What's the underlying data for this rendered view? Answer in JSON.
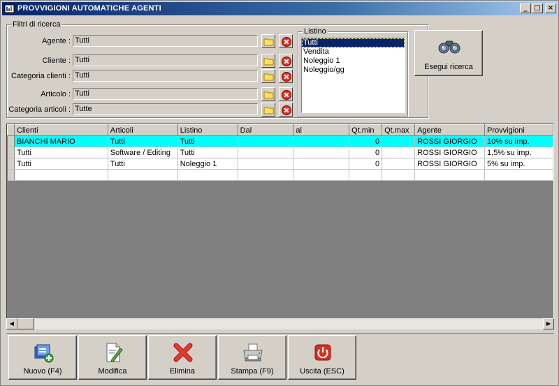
{
  "window": {
    "title": "PROVVIGIONI AUTOMATICHE AGENTI",
    "controls": {
      "minimize": "_",
      "restore": "□",
      "close": "×"
    }
  },
  "filters": {
    "legend": "Filtri di ricerca",
    "agente": {
      "label": "Agente :",
      "value": "Tutti"
    },
    "cliente": {
      "label": "Cliente :",
      "value": "Tutti"
    },
    "categoria_clienti": {
      "label": "Categoria clienti :",
      "value": "Tutti"
    },
    "articolo": {
      "label": "Articolo :",
      "value": "Tutti"
    },
    "categoria_articoli": {
      "label": "Categoria articoli :",
      "value": "Tutte"
    },
    "listino": {
      "legend": "Listino",
      "items": [
        "Tutti",
        "Vendita",
        "Noleggio 1",
        "Noleggio/gg"
      ],
      "selected": "Tutti"
    },
    "search_button": "Esegui ricerca"
  },
  "grid": {
    "columns": [
      "Clienti",
      "Articoli",
      "Listino",
      "Dal",
      "al",
      "Qt.min",
      "Qt.max",
      "Agente",
      "Provvigioni"
    ],
    "rows": [
      [
        "BIANCHI MARIO",
        "Tutti",
        "Tutti",
        "",
        "",
        "0",
        "",
        "ROSSI GIORGIO",
        "10% su imp."
      ],
      [
        "Tutti",
        "Software / Editing",
        "Tutti",
        "",
        "",
        "0",
        "",
        "ROSSI GIORGIO",
        "1,5% su imp."
      ],
      [
        "Tutti",
        "Tutti",
        "Noleggio 1",
        "",
        "",
        "0",
        "",
        "ROSSI GIORGIO",
        "5% su imp."
      ],
      [
        "",
        "",
        "",
        "",
        "",
        "",
        "",
        "",
        ""
      ]
    ],
    "selected_row": 0
  },
  "toolbar": {
    "nuovo": "Nuovo (F4)",
    "modifica": "Modifica",
    "elimina": "Elimina",
    "stampa": "Stampa (F9)",
    "uscita": "Uscita (ESC)"
  },
  "colors": {
    "titlebar": "#0a246a",
    "selected_row": "#00ffff",
    "grid_background": "#808080",
    "window_face": "#d4d0c8"
  }
}
